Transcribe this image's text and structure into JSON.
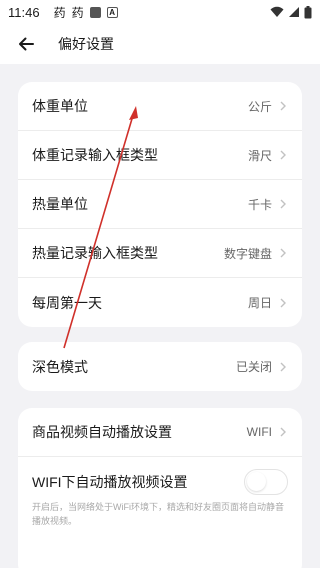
{
  "status_bar": {
    "time": "11:46",
    "app_icon_1": "药",
    "app_icon_2": "药",
    "icons": [
      "wifi-icon",
      "signal-icon",
      "battery-icon"
    ]
  },
  "header": {
    "title": "偏好设置",
    "back_icon": "arrow-left-icon"
  },
  "group1": {
    "rows": [
      {
        "label": "体重单位",
        "value": "公斤"
      },
      {
        "label": "体重记录输入框类型",
        "value": "滑尺"
      },
      {
        "label": "热量单位",
        "value": "千卡"
      },
      {
        "label": "热量记录输入框类型",
        "value": "数字键盘"
      },
      {
        "label": "每周第一天",
        "value": "周日"
      }
    ]
  },
  "group2": {
    "rows": [
      {
        "label": "深色模式",
        "value": "已关闭"
      }
    ]
  },
  "group3": {
    "rows": [
      {
        "label": "商品视频自动播放设置",
        "value": "WIFI"
      },
      {
        "label": "WIFI下自动播放视频设置",
        "toggle_on": false
      }
    ],
    "hint": "开启后，当网络处于WiFi环境下，精选和好友圈页面将自动静音播放视频。"
  },
  "colors": {
    "background": "#f2f2f5",
    "card": "#ffffff",
    "annotation_arrow": "#d0302a"
  }
}
